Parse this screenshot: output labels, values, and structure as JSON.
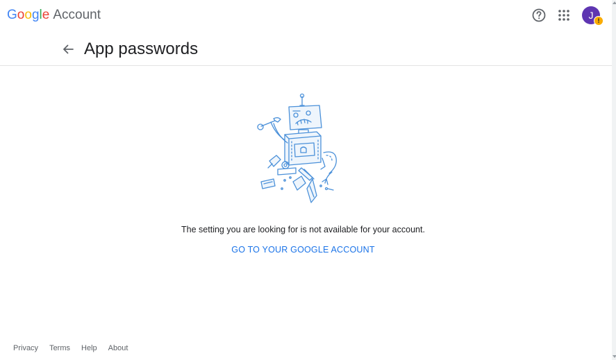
{
  "logo": {
    "letters": [
      {
        "char": "G",
        "color": "#4285f4"
      },
      {
        "char": "o",
        "color": "#ea4335"
      },
      {
        "char": "o",
        "color": "#fbbc05"
      },
      {
        "char": "g",
        "color": "#4285f4"
      },
      {
        "char": "l",
        "color": "#34a853"
      },
      {
        "char": "e",
        "color": "#ea4335"
      }
    ],
    "product": "Account"
  },
  "topbar": {
    "help_icon": "help-circle-icon",
    "apps_icon": "apps-grid-icon",
    "avatar_initial": "J",
    "avatar_color": "#5e35b1",
    "avatar_badge": "!",
    "badge_color": "#f9ab00"
  },
  "header": {
    "back_icon": "arrow-left-icon",
    "title": "App passwords"
  },
  "main": {
    "illustration": "broken-robot-illustration",
    "message": "The setting you are looking for is not available for your account.",
    "link": "GO TO YOUR GOOGLE ACCOUNT",
    "link_color": "#1a73e8"
  },
  "footer": {
    "links": [
      "Privacy",
      "Terms",
      "Help",
      "About"
    ]
  }
}
